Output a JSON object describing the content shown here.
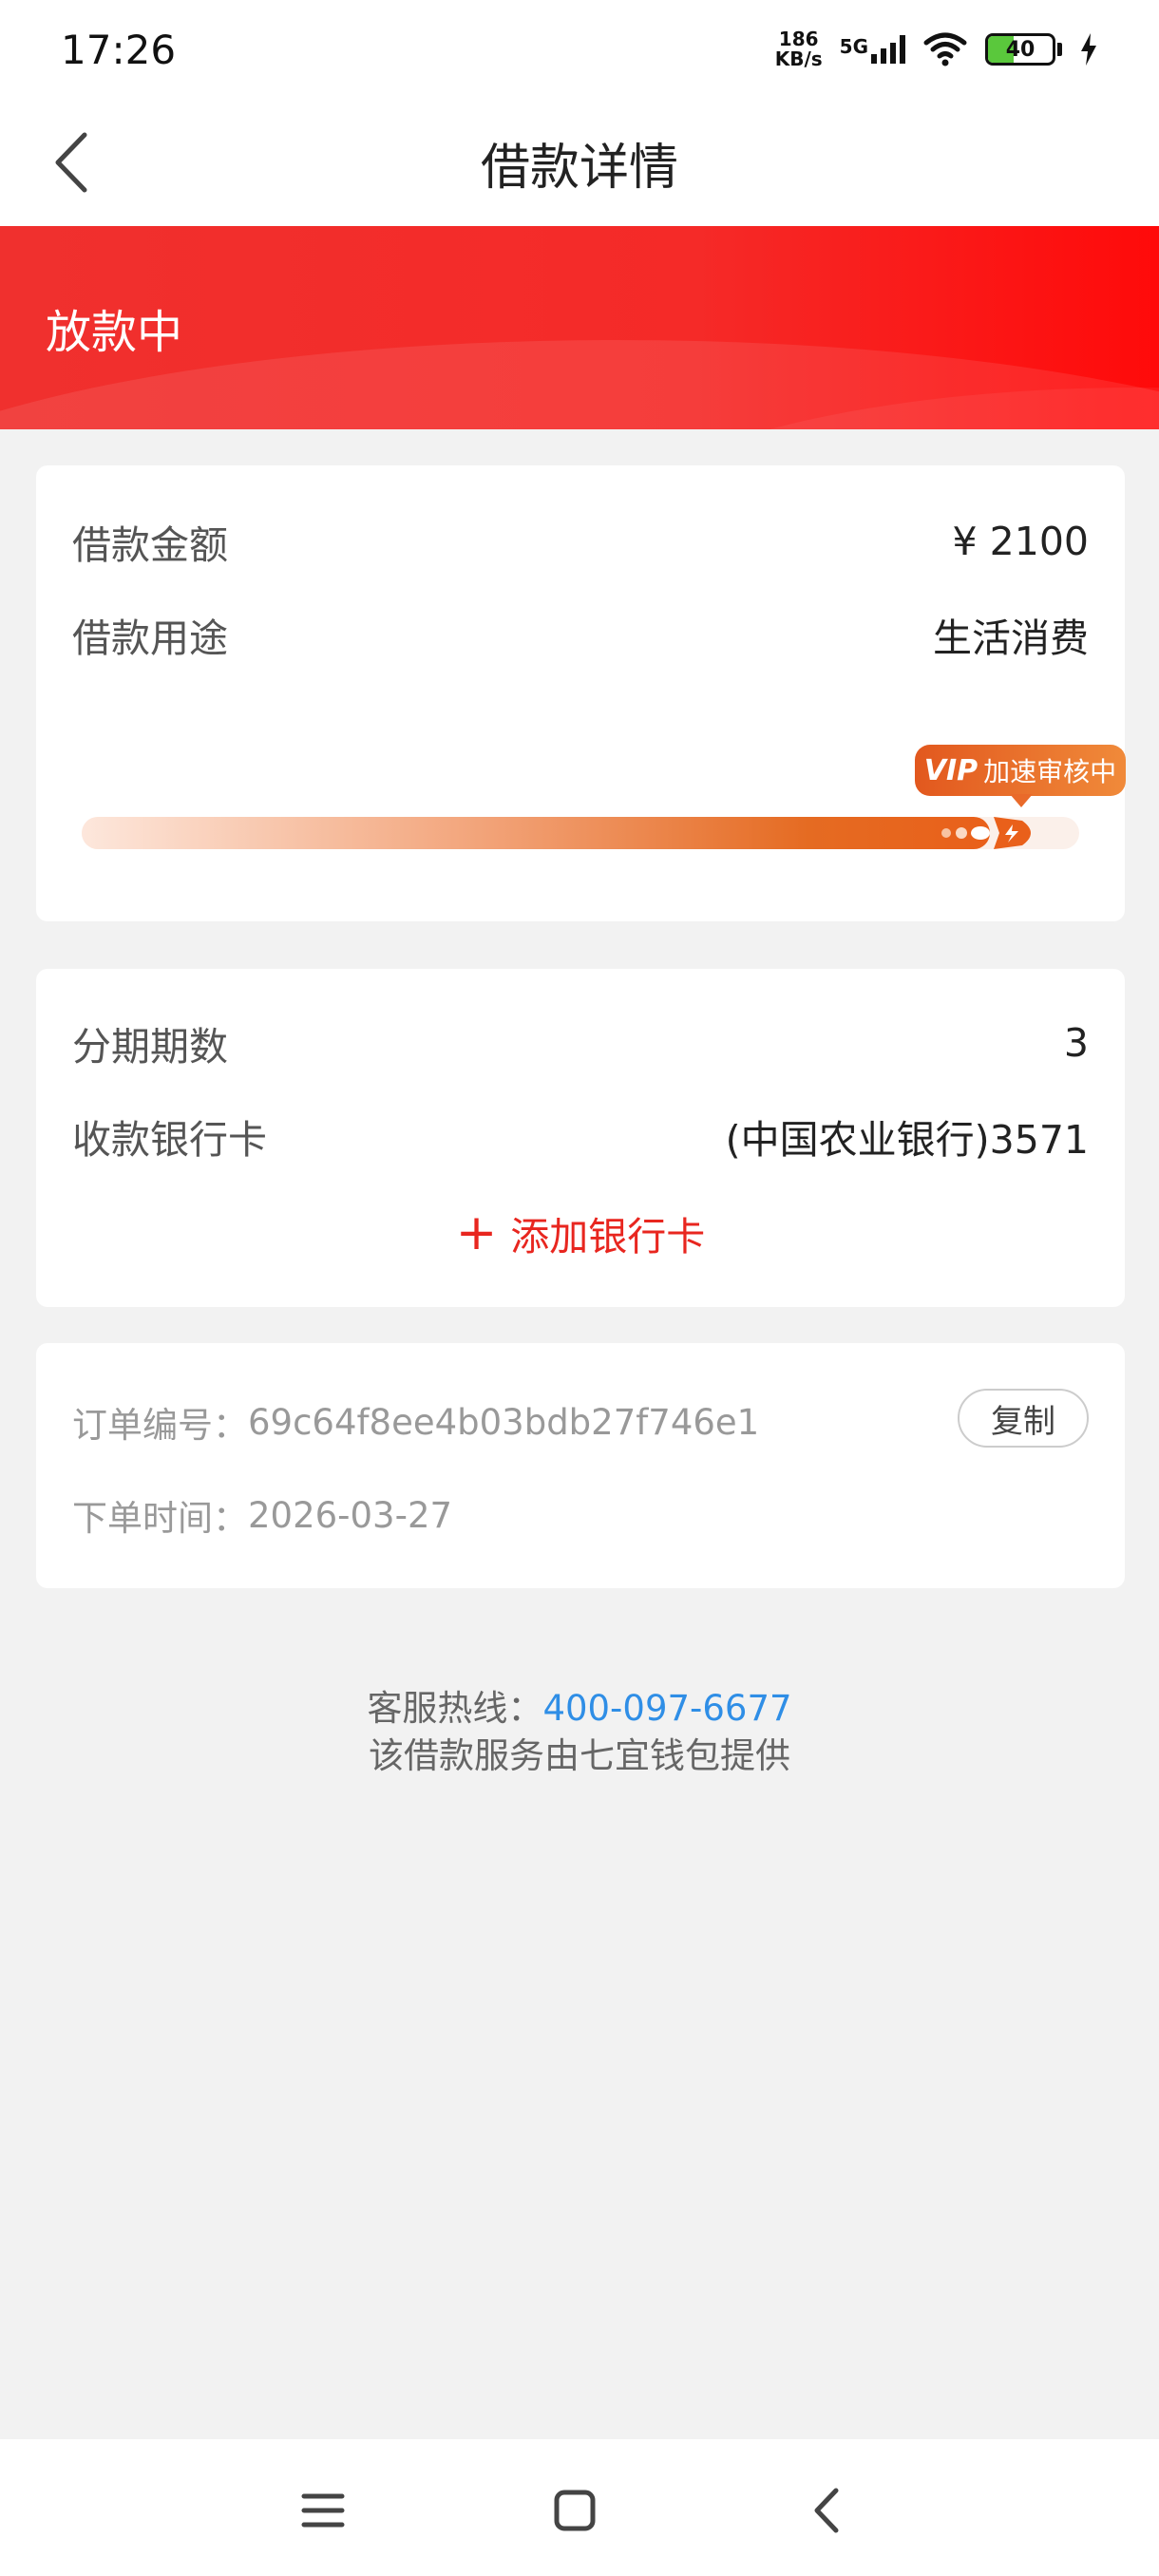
{
  "status_bar": {
    "time": "17:26",
    "speed_value": "186",
    "speed_unit": "KB/s",
    "network": "5G",
    "battery": "40"
  },
  "nav": {
    "title": "借款详情"
  },
  "banner": {
    "status": "放款中"
  },
  "loan": {
    "amount_label": "借款金额",
    "amount_value": "¥ 2100",
    "purpose_label": "借款用途",
    "purpose_value": "生活消费",
    "progress_tag_vip": "VIP",
    "progress_tag_text": "加速审核中",
    "progress_fraction": 0.91
  },
  "repayment": {
    "installments_label": "分期期数",
    "installments_value": "3",
    "bank_label": "收款银行卡",
    "bank_value": "(中国农业银行)3571",
    "add_card_label": "添加银行卡"
  },
  "order": {
    "number_label": "订单编号：",
    "number_value": "69c64f8ee4b03bdb27f746e1",
    "copy_label": "复制",
    "time_label": "下单时间：",
    "time_value": "2026-03-27"
  },
  "footer": {
    "hotline_label": "客服热线：",
    "hotline_number": "400-097-6677",
    "provider_text": "该借款服务由七宜钱包提供"
  },
  "colors": {
    "accent_red": "#e8261f",
    "progress_orange": "#e56b22",
    "link_blue": "#2f8ee6"
  }
}
